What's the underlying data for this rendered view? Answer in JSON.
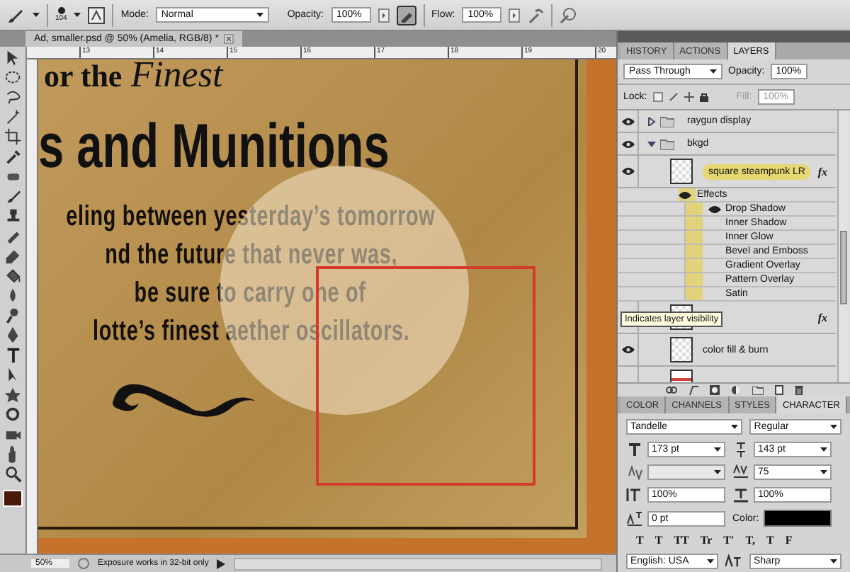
{
  "options_bar": {
    "brush_size": "104",
    "mode_label": "Mode:",
    "mode": "Normal",
    "opacity_label": "Opacity:",
    "opacity": "100%",
    "airbrush_on": true,
    "flow_label": "Flow:",
    "flow": "100%"
  },
  "document": {
    "tab_title": "Ad, smaller.psd @ 50% (Amelia, RGB/8) *",
    "ruler_numbers": [
      "13",
      "14",
      "15",
      "16",
      "17",
      "18",
      "19",
      "20"
    ],
    "poster": {
      "top_line": "or the",
      "script_word": "Finest",
      "title": "s and Munitions",
      "body_lines": [
        "eling between yesterday’s tomorrow",
        "nd the future that never was,",
        "be sure to carry one of",
        "lotte’s finest aether oscillators."
      ]
    }
  },
  "status_bar": {
    "zoom": "50%",
    "message": "Exposure works in 32-bit only"
  },
  "layers_panel": {
    "tabs": [
      {
        "label": "HISTORY",
        "selected": false
      },
      {
        "label": "ACTIONS",
        "selected": false
      },
      {
        "label": "LAYERS",
        "selected": true
      }
    ],
    "blend_mode": "Pass Through",
    "opacity_label": "Opacity:",
    "opacity": "100%",
    "lock_label": "Lock:",
    "fill_label": "Fill:",
    "fill": "100%",
    "layers": [
      {
        "kind": "group",
        "name": "raygun display",
        "visible": true,
        "expanded": false
      },
      {
        "kind": "group",
        "name": "bkgd",
        "visible": true,
        "expanded": true
      },
      {
        "kind": "layer",
        "name": "square steampunk LR",
        "visible": true,
        "fx_badge": "fx",
        "highlighted": true,
        "effects_label": "Effects",
        "effects": [
          {
            "name": "Drop Shadow",
            "visible": true
          },
          {
            "name": "Inner Shadow",
            "visible": false
          },
          {
            "name": "Inner Glow",
            "visible": false
          },
          {
            "name": "Bevel and Emboss",
            "visible": false
          },
          {
            "name": "Gradient Overlay",
            "visible": false
          },
          {
            "name": "Pattern Overlay",
            "visible": false
          },
          {
            "name": "Satin",
            "visible": false
          }
        ]
      },
      {
        "kind": "layer",
        "fx_badge": "fx",
        "tooltip": "Indicates layer visibility"
      },
      {
        "kind": "layer",
        "name": "color fill & burn",
        "visible": true
      },
      {
        "kind": "layer",
        "visible": false
      }
    ]
  },
  "character_panel": {
    "tabs": [
      {
        "label": "COLOR",
        "selected": false
      },
      {
        "label": "CHANNELS",
        "selected": false
      },
      {
        "label": "STYLES",
        "selected": false
      },
      {
        "label": "CHARACTER",
        "selected": true
      }
    ],
    "font": "Tandelle",
    "font_style": "Regular",
    "size": "173 pt",
    "leading": "143 pt",
    "tracking": "75",
    "vertical_scale": "100%",
    "horizontal_scale": "100%",
    "baseline_shift": "0 pt",
    "color_label": "Color:",
    "color": "#000000",
    "style_buttons": [
      "T",
      "T",
      "TT",
      "Tr",
      "T'",
      "T,",
      "T",
      "F"
    ],
    "language": "English: USA",
    "antialias": "Sharp"
  }
}
